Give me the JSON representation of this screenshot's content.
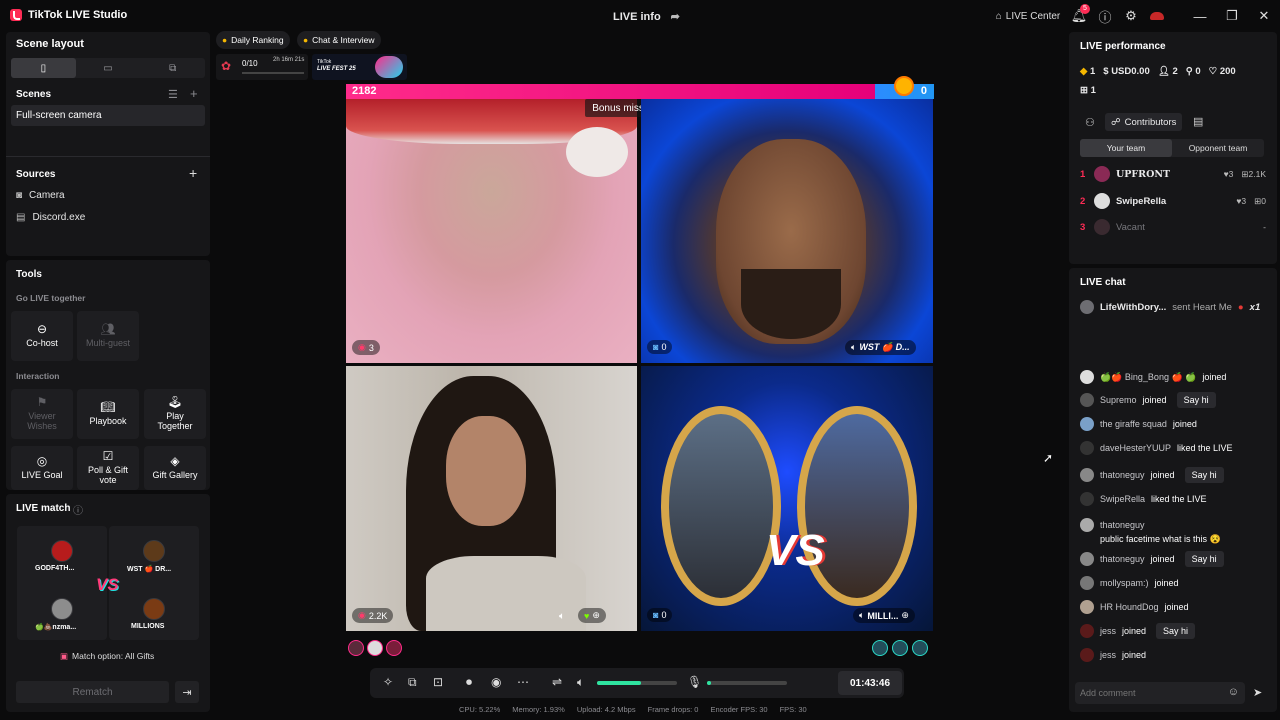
{
  "titlebar": {
    "app_name": "TikTok LIVE Studio",
    "center_title": "LIVE info",
    "live_center": "LIVE Center",
    "notif_count": "5"
  },
  "left": {
    "scene_layout_title": "Scene layout",
    "scenes_title": "Scenes",
    "scene_item": "Full-screen camera",
    "sources_title": "Sources",
    "sources": [
      "Camera",
      "Discord.exe"
    ],
    "tools_title": "Tools",
    "go_live_together": "Go LIVE together",
    "cohost": "Co-host",
    "multiguest": "Multi-guest",
    "interaction": "Interaction",
    "viewer_wishes": "Viewer Wishes",
    "playbook": "Playbook",
    "play_together": "Play Together",
    "live_goal": "LIVE Goal",
    "poll_gift": "Poll & Gift vote",
    "gift_gallery": "Gift Gallery",
    "live_match_title": "LIVE match",
    "players": [
      "GODF4TH...",
      "WST 🍎 DR...",
      "🍏💩nzma...",
      "MILLIONS"
    ],
    "vs": "VS",
    "match_option": "Match option: All Gifts",
    "rematch": "Rematch"
  },
  "top": {
    "daily_ranking": "Daily Ranking",
    "chat_interview": "Chat & Interview",
    "progress": "0/10",
    "timer": "2h 16m 21s",
    "fest_line1": "TikTok",
    "fest_line2": "LIVE FEST 25",
    "progress_fraction": 0.0
  },
  "stage": {
    "score_left": "2182",
    "score_right": "0",
    "bonus": "Bonus mission ended",
    "v1_badge": "3",
    "v2_badge": "0",
    "v2_name": "WST 🍎 D...",
    "v3_badge": "2.2K",
    "v4_badge": "0",
    "v4_name": "MILLI...",
    "vs_text": "VS"
  },
  "controls": {
    "timer": "01:43:46",
    "volume_fraction": 0.55,
    "mic_fraction": 0.05
  },
  "stats": {
    "cpu": "CPU:  5.22%",
    "memory": "Memory:  1.93%",
    "upload": "Upload:  4.2 Mbps",
    "drops": "Frame drops:  0",
    "encoder": "Encoder FPS:  30",
    "fps": "FPS:  30"
  },
  "right": {
    "perf_title": "LIVE performance",
    "diamonds": "1",
    "usd": "USD0.00",
    "users": "2",
    "follows": "0",
    "likes": "200",
    "gifts": "1",
    "contributors": "Contributors",
    "your_team": "Your team",
    "opponent_team": "Opponent team",
    "team": [
      {
        "rank": "1",
        "name": "UPFRONT",
        "likes": "3",
        "score": "2.1K"
      },
      {
        "rank": "2",
        "name": "SwipeRella",
        "likes": "3",
        "score": "0"
      },
      {
        "rank": "3",
        "name": "Vacant",
        "likes": "",
        "score": "-"
      }
    ],
    "chat_title": "LIVE chat",
    "pinned_user": "LifeWithDory...",
    "pinned_text": "sent Heart Me",
    "pinned_count": "x1",
    "chat": [
      {
        "user": "🍏🍎 Bing_Bong 🍎 🍏",
        "text": "joined",
        "hi": ""
      },
      {
        "user": "Supremo",
        "text": "joined",
        "hi": "Say hi"
      },
      {
        "user": "the giraffe squad",
        "text": "joined",
        "hi": ""
      },
      {
        "user": "daveHesterYUUP",
        "text": "liked the LIVE",
        "hi": ""
      },
      {
        "user": "thatoneguy",
        "text": "joined",
        "hi": "Say hi"
      },
      {
        "user": "SwipeRella",
        "text": "liked the LIVE",
        "hi": ""
      },
      {
        "user": "thatoneguy",
        "text": "public facetime what is this 😵",
        "hi": ""
      },
      {
        "user": "thatoneguy",
        "text": "joined",
        "hi": "Say hi"
      },
      {
        "user": "mollyspam:)",
        "text": "joined",
        "hi": ""
      },
      {
        "user": "HR HoundDog",
        "text": "joined",
        "hi": ""
      },
      {
        "user": "jess",
        "text": "joined",
        "hi": "Say hi"
      },
      {
        "user": "jess",
        "text": "joined",
        "hi": ""
      }
    ],
    "comment_placeholder": "Add comment"
  }
}
